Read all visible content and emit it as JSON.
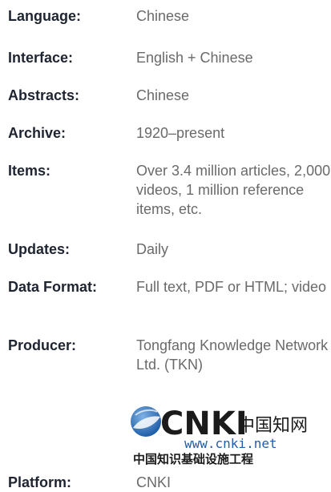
{
  "rows": {
    "language": {
      "label": "Language:",
      "value": "Chinese"
    },
    "interface": {
      "label": "Interface:",
      "value": "English + Chinese"
    },
    "abstracts": {
      "label": "Abstracts:",
      "value": "Chinese"
    },
    "archive": {
      "label": "Archive:",
      "value": "1920–present"
    },
    "items": {
      "label": "Items:",
      "value": "Over 3.4 million articles, 2,000 videos, 1 million reference items, etc."
    },
    "updates": {
      "label": "Updates:",
      "value": "Daily"
    },
    "data_format": {
      "label": "Data Format:",
      "value": "Full text, PDF or HTML; video"
    },
    "producer": {
      "label": "Producer:",
      "value": "Tongfang Knowledge Network Ltd. (TKN)"
    },
    "platform": {
      "label": "Platform:",
      "value": "CNKI"
    }
  },
  "logo": {
    "brand": "CNKI",
    "chinese_name": "中国知网",
    "url": "www.cnki.net",
    "tagline": "中国知识基础设施工程"
  },
  "colors": {
    "label": "#1e2430",
    "value": "#6a6a6a",
    "logo_dark": "#1b1b1b",
    "logo_blue": "#1f5ea8"
  }
}
